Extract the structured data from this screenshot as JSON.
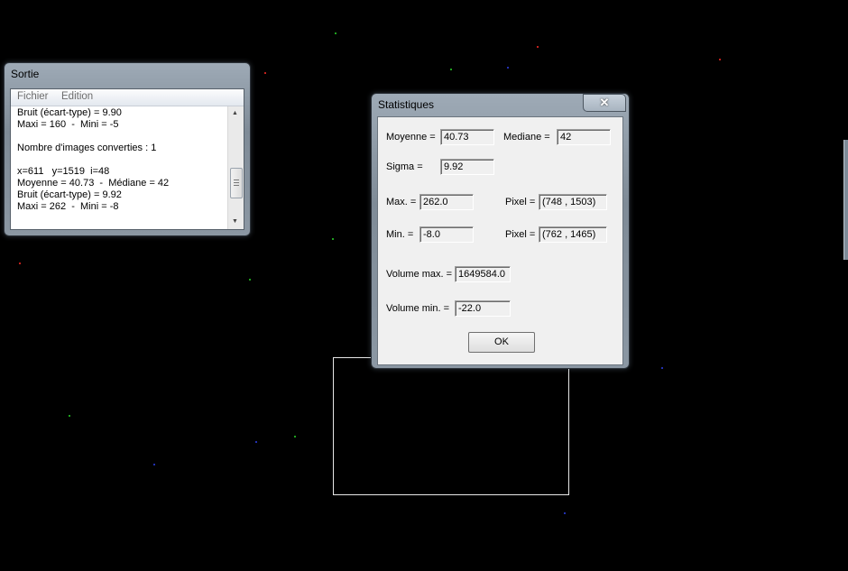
{
  "sortie": {
    "title": "Sortie",
    "menu": [
      "Fichier",
      "Edition"
    ],
    "lines": [
      "Bruit (écart-type) = 9.90",
      "Maxi = 160  -  Mini = -5",
      "",
      "Nombre d'images converties : 1",
      "",
      "x=611   y=1519  i=48",
      "Moyenne = 40.73  -  Médiane = 42",
      "Bruit (écart-type) = 9.92",
      "Maxi = 262  -  Mini = -8"
    ]
  },
  "stats": {
    "title": "Statistiques",
    "close_glyph": "✕",
    "moyenne_label": "Moyenne =",
    "moyenne_value": "40.73",
    "mediane_label": "Mediane =",
    "mediane_value": "42",
    "sigma_label": "Sigma =",
    "sigma_value": "9.92",
    "max_label": "Max. =",
    "max_value": "262.0",
    "max_pixel_label": "Pixel =",
    "max_pixel_value": "(748 , 1503)",
    "min_label": "Min. =",
    "min_value": "-8.0",
    "min_pixel_label": "Pixel =",
    "min_pixel_value": "(762 , 1465)",
    "volume_max_label": "Volume max. =",
    "volume_max_value": "1649584.0",
    "volume_min_label": "Volume min. =",
    "volume_min_value": "-22.0",
    "ok_label": "OK"
  },
  "colors": {
    "background": "#000000",
    "star_red": "#c0201c",
    "star_green": "#1fa21f",
    "star_blue": "#2230b0",
    "selection_rectangle": "#e8e8e8"
  }
}
